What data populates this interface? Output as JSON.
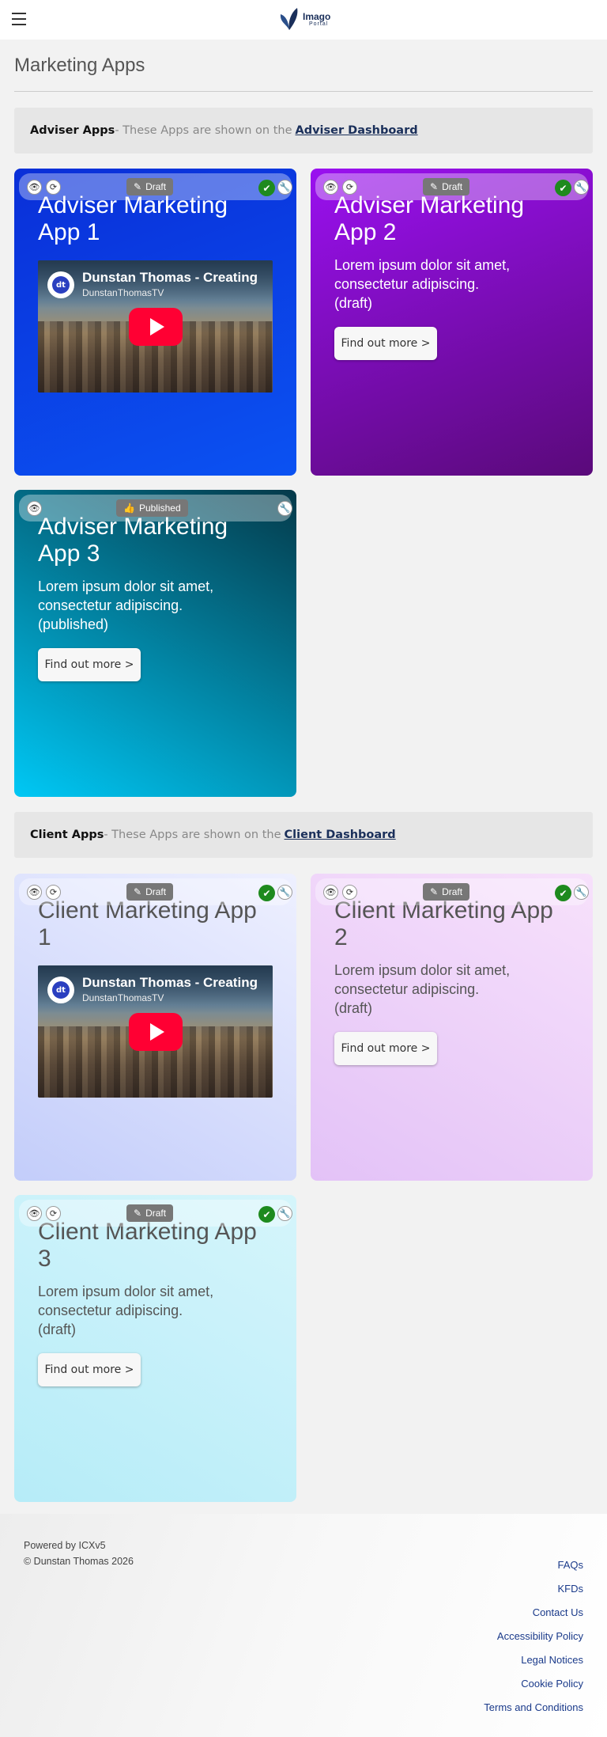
{
  "header": {
    "logo_name": "Imago",
    "logo_sub": "Portal",
    "menu_icon": "hamburger-menu-icon"
  },
  "page": {
    "title": "Marketing Apps"
  },
  "adviser_section": {
    "label": "Adviser Apps",
    "sep": " - These Apps are shown on the",
    "link": "Adviser Dashboard"
  },
  "client_section": {
    "label": "Client Apps",
    "sep": " - These Apps are shown on the",
    "link": "Client Dashboard"
  },
  "video": {
    "title": "Dunstan Thomas - Creating",
    "channel": "DunstanThomasTV",
    "channel_initials": "dt"
  },
  "cards": {
    "a1": {
      "status": "Draft",
      "title": "Adviser Marketing App 1"
    },
    "a2": {
      "status": "Draft",
      "title": "Adviser Marketing App 2",
      "desc": "Lorem ipsum dolor sit amet, consectetur adipiscing. (draft)",
      "button": "Find out more >"
    },
    "a3": {
      "status": "Published",
      "title": "Adviser Marketing App 3",
      "desc": "Lorem ipsum dolor sit amet, consectetur adipiscing. (published)",
      "button": "Find out more >"
    },
    "c1": {
      "status": "Draft",
      "title": "Client Marketing App 1"
    },
    "c2": {
      "status": "Draft",
      "title": "Client Marketing App 2",
      "desc": "Lorem ipsum dolor sit amet, consectetur adipiscing. (draft)",
      "button": "Find out more >"
    },
    "c3": {
      "status": "Draft",
      "title": "Client Marketing App 3",
      "desc": "Lorem ipsum dolor sit amet, consectetur adipiscing. (draft)",
      "button": "Find out more >"
    }
  },
  "colors": {
    "a1_gradient": [
      "#0a2fd8",
      "#0b52f2"
    ],
    "a2_gradient": [
      "#9a10f0",
      "#5a0a7a"
    ],
    "a3_gradient": [
      "#00c8f5",
      "#053a4a"
    ],
    "c1_gradient": [
      "#c3cdfa",
      "#eef0ff"
    ],
    "c2_gradient": [
      "#e3c2f7",
      "#f7e1fb"
    ],
    "c3_gradient": [
      "#b6ecf8",
      "#d5f5fb"
    ],
    "link": "#1a2f5a",
    "check": "#1e8a1e"
  },
  "footer": {
    "powered": "Powered by ICXv5",
    "copyright": "© Dunstan Thomas 2026",
    "links": [
      "FAQs",
      "KFDs",
      "Contact Us",
      "Accessibility Policy",
      "Legal Notices",
      "Cookie Policy",
      "Terms and Conditions"
    ]
  }
}
